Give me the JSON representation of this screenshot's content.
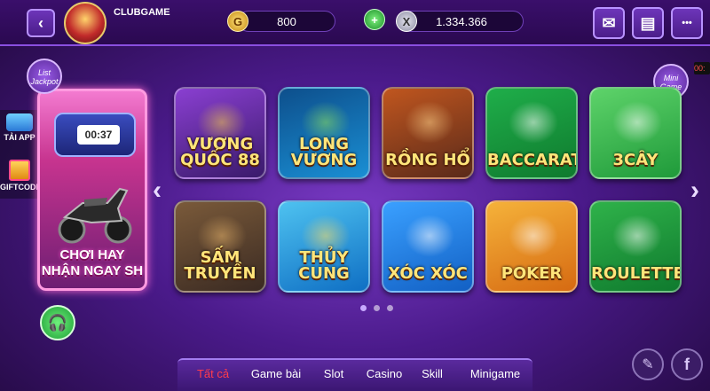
{
  "header": {
    "username": "CLUBGAME",
    "gold_icon_glyph": "G",
    "gold_balance": "800",
    "add_glyph": "+",
    "xu_icon_glyph": "X",
    "xu_balance": "1.334.366",
    "icons": [
      "back-icon",
      "mail-icon",
      "shop-icon",
      "more-icon"
    ]
  },
  "left_panel": {
    "jackpot_label": "List Jackpot",
    "promo_timer": "00:37",
    "promo_text_line1": "CHƠI HAY",
    "promo_text_line2": "NHẬN NGAY SH",
    "tai_app_label": "TẢI APP",
    "giftcode_label": "GIFTCODE"
  },
  "right_panel": {
    "minigame_label": "Mini Game",
    "minigame_timer": "00:"
  },
  "games": [
    {
      "label": "VƯƠNG QUỐC 88",
      "colors": [
        "#3a1a6b",
        "#8a3fd1"
      ],
      "accent": "#f2c94c"
    },
    {
      "label": "LONG VƯƠNG",
      "colors": [
        "#1a8fd4",
        "#0d4f8c"
      ],
      "accent": "#8ee05c"
    },
    {
      "label": "RỒNG HỔ",
      "colors": [
        "#5a2a1a",
        "#c0561f"
      ],
      "accent": "#ffd38a"
    },
    {
      "label": "BACCARAT",
      "colors": [
        "#0f7a2e",
        "#1fae4a"
      ],
      "accent": "#ffffff"
    },
    {
      "label": "3CÂY",
      "colors": [
        "#1f9a3a",
        "#5ed36a"
      ],
      "accent": "#ffffff"
    },
    {
      "label": "SẤM TRUYỀN",
      "colors": [
        "#3a2a22",
        "#7a5a3a"
      ],
      "accent": "#e6b36a"
    },
    {
      "label": "THỦY CUNG",
      "colors": [
        "#0f6fc4",
        "#4ec2f0"
      ],
      "accent": "#ffe066"
    },
    {
      "label": "XÓC XÓC",
      "colors": [
        "#1260c4",
        "#3aa0ff"
      ],
      "accent": "#ffffff"
    },
    {
      "label": "POKER",
      "colors": [
        "#d66a12",
        "#f5b23a"
      ],
      "accent": "#ffffff"
    },
    {
      "label": "ROULETTE",
      "colors": [
        "#0f7a2e",
        "#2fb24a"
      ],
      "accent": "#ffffff"
    }
  ],
  "pagination": {
    "pages": 3,
    "current": 0
  },
  "tabs": [
    "Tất cả",
    "Game bài",
    "Slot",
    "Casino",
    "Skill",
    "Minigame"
  ],
  "active_tab": 0,
  "glyphs": {
    "back": "‹",
    "mail": "✉",
    "shop": "▤",
    "more": "•••",
    "prev": "‹",
    "next": "›",
    "edit": "✎",
    "facebook": "f",
    "headset": "🎧"
  }
}
